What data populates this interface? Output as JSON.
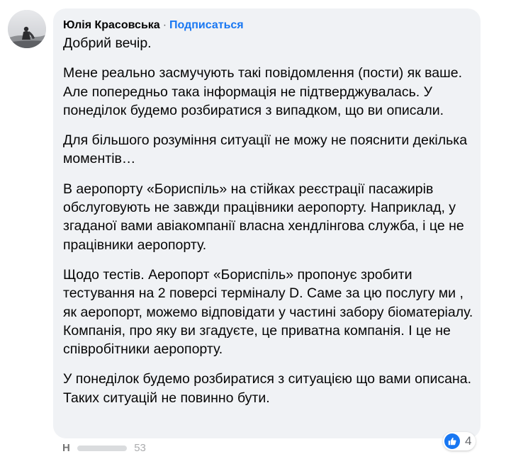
{
  "comment": {
    "author": "Юлія Красовська",
    "separator": "·",
    "follow_label": "Подписаться",
    "paragraphs": [
      "Добрий вечір.",
      "Мене реально засмучують такі повідомлення (пости) як ваше. Але попередньо така інформація не підтверджувалась. У понеділок будемо розбиратися з випадком, що ви описали.",
      "Для більшого розуміння ситуації не можу не пояснити декілька моментів…",
      "В аеропорту «Бориспіль» на стійках реєстрації пасажирів обслуговують не завжди працівники аеропорту. Наприклад, у згаданої вами авіакомпанії власна хендлінгова служба, і це не працівники аеропорту.",
      "Щодо тестів. Аеропорт «Бориспіль» пропонує зробити тестування на 2 поверсі терміналу D. Саме за цю послугу ми , як аеропорт, можемо відповідати у частині забору біоматеріалу.",
      "Компанія, про яку ви згадуєте, це приватна компанія. І це не співробітники аеропорту.",
      "У понеділок будемо розбиратися з ситуацією що вами описана. Таких ситуацій не повинно бути."
    ],
    "reactions": {
      "icon": "like-icon",
      "count": "4"
    }
  },
  "next_comment": {
    "author_partial": "Н",
    "count_partial": "53"
  },
  "colors": {
    "bubble": "#f0f2f5",
    "link": "#1877f2",
    "text": "#050505",
    "muted": "#65676b"
  }
}
